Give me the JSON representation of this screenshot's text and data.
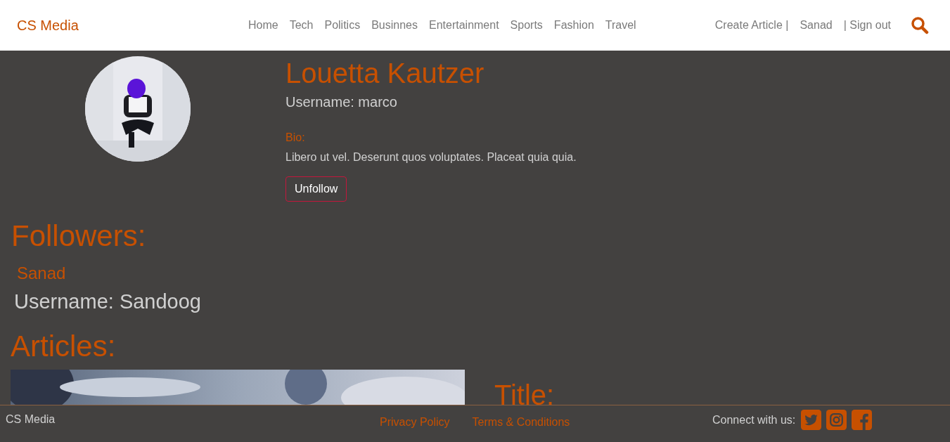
{
  "navbar": {
    "brand": "CS Media",
    "links": [
      {
        "label": "Home"
      },
      {
        "label": "Tech"
      },
      {
        "label": "Politics"
      },
      {
        "label": "Businnes"
      },
      {
        "label": "Entertainment"
      },
      {
        "label": "Sports"
      },
      {
        "label": "Fashion"
      },
      {
        "label": "Travel"
      }
    ],
    "user_links": [
      {
        "label": "Create Article |"
      },
      {
        "label": "Sanad"
      },
      {
        "label": "| Sign out"
      }
    ]
  },
  "profile": {
    "name": "Louetta Kautzer",
    "username": "Username: marco",
    "bio_label": "Bio:",
    "bio": "Libero ut vel. Deserunt quos voluptates. Placeat quia quia.",
    "follow_button": "Unfollow"
  },
  "followers": {
    "heading": "Followers:",
    "items": [
      {
        "name": "Sanad",
        "username": "Username: Sandoog"
      }
    ]
  },
  "articles": {
    "heading": "Articles:",
    "items": [
      {
        "title": "Title:"
      }
    ]
  },
  "footer": {
    "brand": "CS Media",
    "links": [
      {
        "label": "Privacy Policy"
      },
      {
        "label": "Terms & Conditions"
      }
    ],
    "connect": "Connect with us:"
  }
}
